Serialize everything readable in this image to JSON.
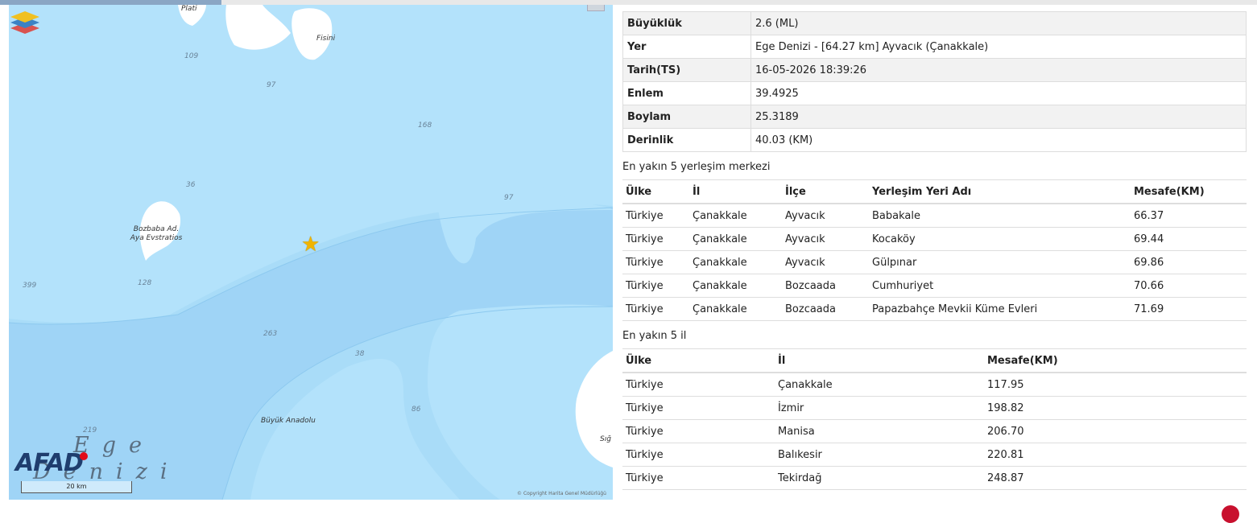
{
  "map": {
    "place_labels": {
      "plati": "Plati",
      "fisini": "Fisini",
      "bozbaba_line1": "Bozbaba Ad.",
      "bozbaba_line2": "Aya Evstratios",
      "buyuk_anadolu": "Büyük Anadolu",
      "sig": "Sığ"
    },
    "depths": [
      "109",
      "97",
      "168",
      "36",
      "97",
      "128",
      "399",
      "263",
      "38",
      "86",
      "219"
    ],
    "sea_line1": "Ege",
    "sea_line2": "Denizi",
    "logo": "AFAD",
    "scale": "20 km",
    "copyright": "© Copyright Harita Genel Müdürlüğü"
  },
  "info": [
    {
      "key": "Büyüklük",
      "value": "2.6 (ML)"
    },
    {
      "key": "Yer",
      "value": "Ege Denizi - [64.27 km] Ayvacık (Çanakkale)"
    },
    {
      "key": "Tarih(TS)",
      "value": "16-05-2026 18:39:26"
    },
    {
      "key": "Enlem",
      "value": "39.4925"
    },
    {
      "key": "Boylam",
      "value": "25.3189"
    },
    {
      "key": "Derinlik",
      "value": "40.03 (KM)"
    }
  ],
  "settlements": {
    "title": "En yakın 5 yerleşim merkezi",
    "headers": [
      "Ülke",
      "İl",
      "İlçe",
      "Yerleşim Yeri Adı",
      "Mesafe(KM)"
    ],
    "rows": [
      [
        "Türkiye",
        "Çanakkale",
        "Ayvacık",
        "Babakale",
        "66.37"
      ],
      [
        "Türkiye",
        "Çanakkale",
        "Ayvacık",
        "Kocaköy",
        "69.44"
      ],
      [
        "Türkiye",
        "Çanakkale",
        "Ayvacık",
        "Gülpınar",
        "69.86"
      ],
      [
        "Türkiye",
        "Çanakkale",
        "Bozcaada",
        "Cumhuriyet",
        "70.66"
      ],
      [
        "Türkiye",
        "Çanakkale",
        "Bozcaada",
        "Papazbahçe Mevkii Küme Evleri",
        "71.69"
      ]
    ]
  },
  "provinces": {
    "title": "En yakın 5 il",
    "headers": [
      "Ülke",
      "İl",
      "Mesafe(KM)"
    ],
    "rows": [
      [
        "Türkiye",
        "Çanakkale",
        "117.95"
      ],
      [
        "Türkiye",
        "İzmir",
        "198.82"
      ],
      [
        "Türkiye",
        "Manisa",
        "206.70"
      ],
      [
        "Türkiye",
        "Balıkesir",
        "220.81"
      ],
      [
        "Türkiye",
        "Tekirdağ",
        "248.87"
      ]
    ]
  }
}
